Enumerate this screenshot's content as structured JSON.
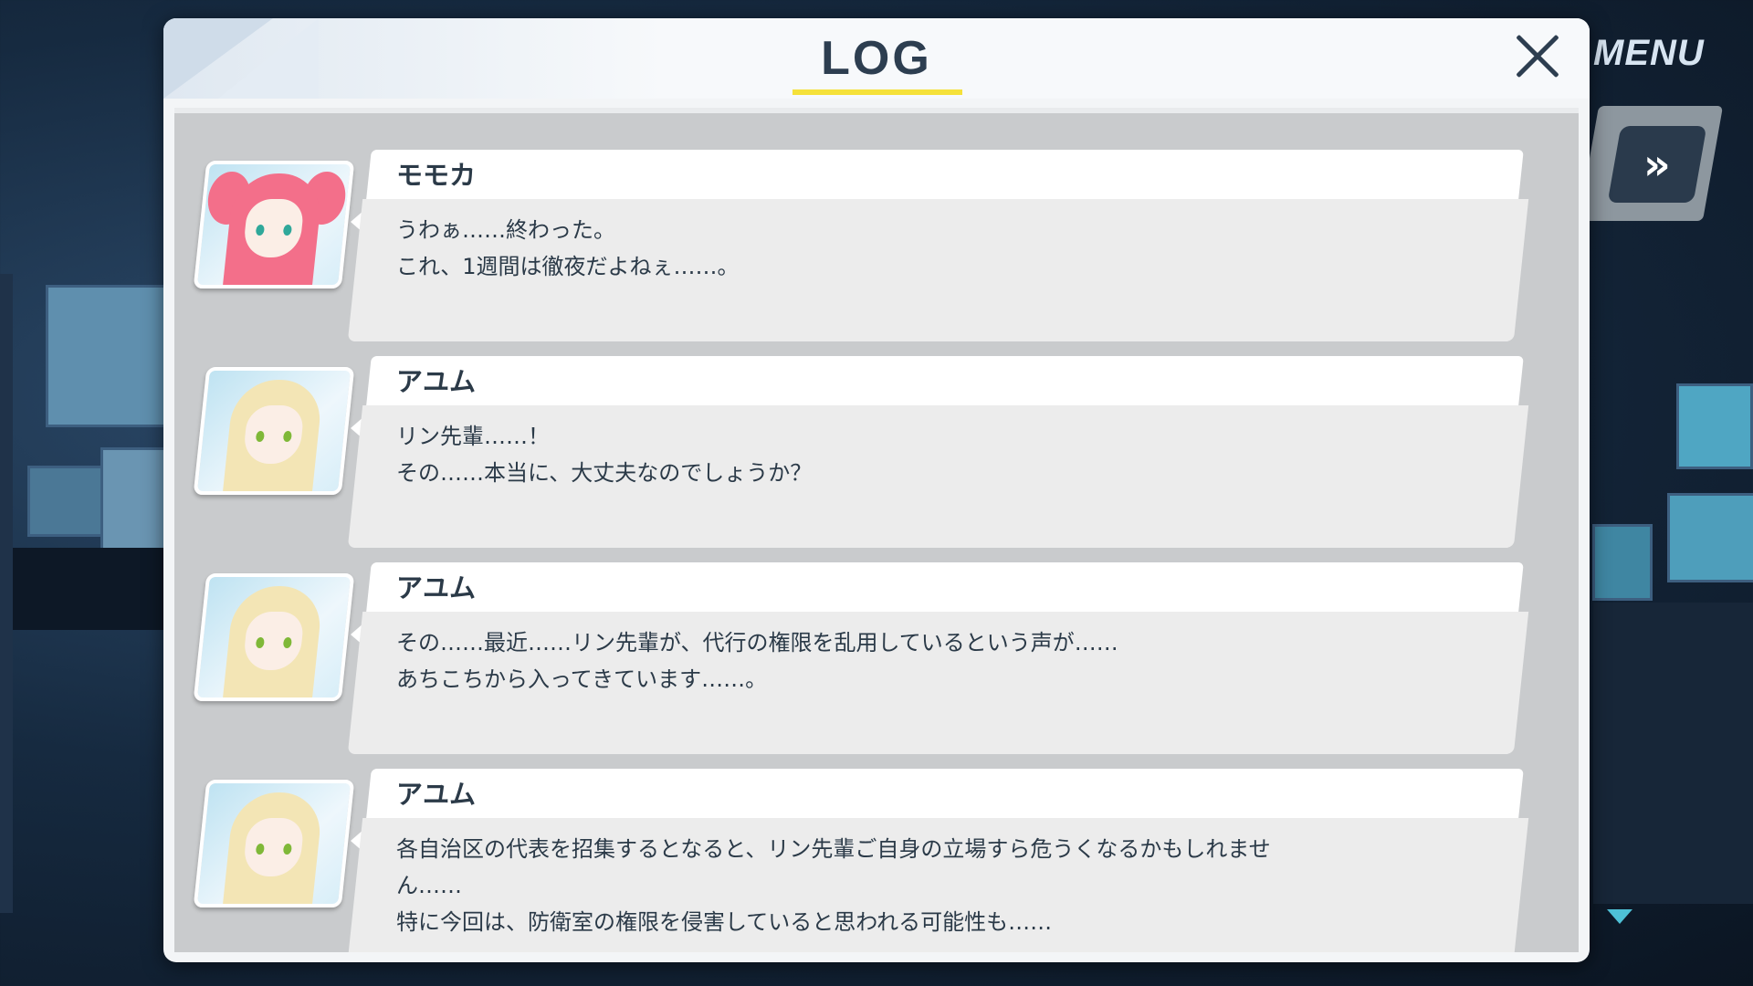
{
  "header": {
    "title": "LOG",
    "menu_label": "MENU",
    "skip_label": "»"
  },
  "entries": [
    {
      "speaker": "モモカ",
      "portrait": "momoka-portrait",
      "lines": [
        "うわぁ……終わった。",
        "これ、1週間は徹夜だよねぇ……。"
      ]
    },
    {
      "speaker": "アユム",
      "portrait": "ayumu-portrait",
      "lines": [
        "リン先輩……！",
        "その……本当に、大丈夫なのでしょうか？"
      ]
    },
    {
      "speaker": "アユム",
      "portrait": "ayumu-portrait",
      "lines": [
        "その……最近……リン先輩が、代行の権限を乱用しているという声が……",
        "あちこちから入ってきています……。"
      ]
    },
    {
      "speaker": "アユム",
      "portrait": "ayumu-portrait",
      "lines": [
        "各自治区の代表を招集するとなると、リン先輩ご自身の立場すら危うくなるかもしれませ",
        "ん……",
        "特に今回は、防衛室の権限を侵害していると思われる可能性も……"
      ]
    }
  ],
  "colors": {
    "accent_underline": "#f5e13a",
    "text_dark": "#2b3a48",
    "scroll_arrow": "#4ec1d6"
  },
  "icons": {
    "close": "close-icon",
    "skip": "fast-forward-icon",
    "scroll_down": "triangle-down-icon"
  }
}
